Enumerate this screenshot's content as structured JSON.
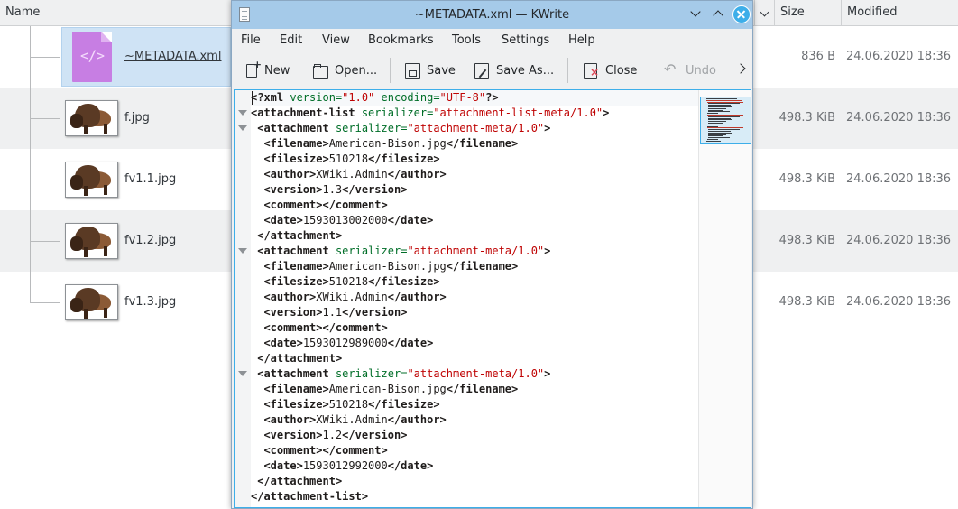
{
  "file_manager": {
    "columns": {
      "name": "Name",
      "size": "Size",
      "modified": "Modified"
    },
    "files": [
      {
        "name": "~METADATA.xml",
        "size": "836 B",
        "modified": "24.06.2020 18:36",
        "selected": true,
        "icon": "xml-file-icon"
      },
      {
        "name": "f.jpg",
        "size": "498.3 KiB",
        "modified": "24.06.2020 18:36",
        "icon": "bison-thumbnail"
      },
      {
        "name": "fv1.1.jpg",
        "size": "498.3 KiB",
        "modified": "24.06.2020 18:36",
        "icon": "bison-thumbnail"
      },
      {
        "name": "fv1.2.jpg",
        "size": "498.3 KiB",
        "modified": "24.06.2020 18:36",
        "icon": "bison-thumbnail"
      },
      {
        "name": "fv1.3.jpg",
        "size": "498.3 KiB",
        "modified": "24.06.2020 18:36",
        "icon": "bison-thumbnail"
      }
    ]
  },
  "kwrite": {
    "title": "~METADATA.xml — KWrite",
    "menu": [
      "File",
      "Edit",
      "View",
      "Bookmarks",
      "Tools",
      "Settings",
      "Help"
    ],
    "toolbar": {
      "new": "New",
      "open": "Open...",
      "save": "Save",
      "save_as": "Save As...",
      "close": "Close",
      "undo": "Undo"
    },
    "document": {
      "lines": [
        "<?xml version=\"1.0\" encoding=\"UTF-8\"?>",
        "<attachment-list serializer=\"attachment-list-meta/1.0\">",
        " <attachment serializer=\"attachment-meta/1.0\">",
        "  <filename>American-Bison.jpg</filename>",
        "  <filesize>510218</filesize>",
        "  <author>XWiki.Admin</author>",
        "  <version>1.3</version>",
        "  <comment></comment>",
        "  <date>1593013002000</date>",
        " </attachment>",
        " <attachment serializer=\"attachment-meta/1.0\">",
        "  <filename>American-Bison.jpg</filename>",
        "  <filesize>510218</filesize>",
        "  <author>XWiki.Admin</author>",
        "  <version>1.1</version>",
        "  <comment></comment>",
        "  <date>1593012989000</date>",
        " </attachment>",
        " <attachment serializer=\"attachment-meta/1.0\">",
        "  <filename>American-Bison.jpg</filename>",
        "  <filesize>510218</filesize>",
        "  <author>XWiki.Admin</author>",
        "  <version>1.2</version>",
        "  <comment></comment>",
        "  <date>1593012992000</date>",
        " </attachment>",
        "</attachment-list>"
      ]
    }
  },
  "colors": {
    "accent": "#3daee9",
    "titlebar": "#a5cae9",
    "selection": "#cfe3f5",
    "xml_icon": "#c77ee3",
    "syntax_attribute": "#006e28",
    "syntax_value": "#bf0303"
  }
}
